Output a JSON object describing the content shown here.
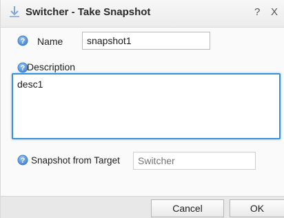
{
  "window": {
    "title": "Switcher - Take Snapshot",
    "title_icon": "download-arrow-icon",
    "help_label": "?",
    "close_label": "X"
  },
  "form": {
    "name_label": "Name",
    "name_value": "snapshot1",
    "description_label": "Description",
    "description_value": "desc1",
    "snapshot_from_target_label": "Snapshot from Target",
    "snapshot_from_target_placeholder": "Switcher"
  },
  "buttons": {
    "cancel_label": "Cancel",
    "ok_label": "OK"
  },
  "colors": {
    "info_icon": "#3d7fd0",
    "focus_border": "#3a8fd8"
  }
}
